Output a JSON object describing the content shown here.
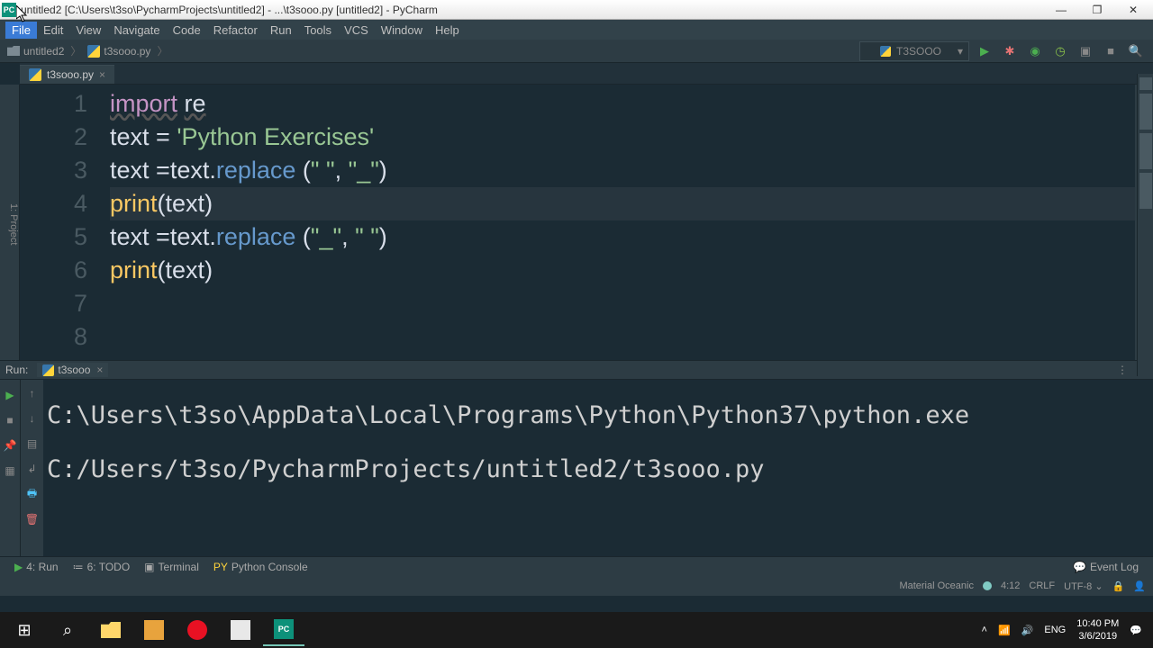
{
  "window": {
    "title": "untitled2 [C:\\Users\\t3so\\PycharmProjects\\untitled2] - ...\\t3sooo.py [untitled2] - PyCharm"
  },
  "menu": [
    "File",
    "Edit",
    "View",
    "Navigate",
    "Code",
    "Refactor",
    "Run",
    "Tools",
    "VCS",
    "Window",
    "Help"
  ],
  "breadcrumb": {
    "project": "untitled2",
    "file": "t3sooo.py"
  },
  "run_config": "T3SOOO",
  "tab": {
    "name": "t3sooo.py"
  },
  "left_gutter": "1: Project",
  "editor": {
    "lines": [
      "1",
      "2",
      "3",
      "4",
      "5",
      "6",
      "7",
      "8"
    ],
    "code": [
      {
        "t": "import",
        "c": "kw imp-u"
      },
      {
        "t": " ",
        "c": ""
      },
      {
        "t": "re",
        "c": "var imp-u"
      },
      {
        "nl": 1
      },
      {
        "t": "text ",
        "c": "var"
      },
      {
        "t": "= ",
        "c": "op"
      },
      {
        "t": "'Python Exercises'",
        "c": "str"
      },
      {
        "nl": 1
      },
      {
        "t": "text ",
        "c": "var"
      },
      {
        "t": "=",
        "c": "op"
      },
      {
        "t": "text",
        "c": "var"
      },
      {
        "t": ".",
        "c": "op"
      },
      {
        "t": "replace",
        "c": "fn"
      },
      {
        "t": " (",
        "c": "op"
      },
      {
        "t": "\" \"",
        "c": "str"
      },
      {
        "t": ", ",
        "c": "op"
      },
      {
        "t": "\"_\"",
        "c": "str"
      },
      {
        "t": ")",
        "c": "op"
      },
      {
        "nl": 1
      },
      {
        "t": "print",
        "c": "bi"
      },
      {
        "t": "(",
        "c": "op"
      },
      {
        "t": "text",
        "c": "var"
      },
      {
        "t": ")",
        "c": "op"
      },
      {
        "nl": 1,
        "hl": 1
      },
      {
        "t": "text ",
        "c": "var"
      },
      {
        "t": "=",
        "c": "op"
      },
      {
        "t": "text",
        "c": "var"
      },
      {
        "t": ".",
        "c": "op"
      },
      {
        "t": "replace",
        "c": "fn"
      },
      {
        "t": " (",
        "c": "op"
      },
      {
        "t": "\"_\"",
        "c": "str"
      },
      {
        "t": ", ",
        "c": "op"
      },
      {
        "t": "\" \"",
        "c": "str"
      },
      {
        "t": ")",
        "c": "op"
      },
      {
        "nl": 1
      },
      {
        "t": "print",
        "c": "bi"
      },
      {
        "t": "(",
        "c": "op"
      },
      {
        "t": "text",
        "c": "var"
      },
      {
        "t": ")",
        "c": "op"
      },
      {
        "nl": 1
      },
      {
        "t": "",
        "c": ""
      },
      {
        "nl": 1
      },
      {
        "t": "",
        "c": ""
      },
      {
        "nl": 1
      }
    ]
  },
  "run": {
    "label": "Run:",
    "tab": "t3sooo",
    "output": "C:\\Users\\t3so\\AppData\\Local\\Programs\\Python\\Python37\\python.exe C:/Users/t3so/PycharmProjects/untitled2/t3sooo.py"
  },
  "bottom": {
    "run": "4: Run",
    "todo": "6: TODO",
    "terminal": "Terminal",
    "python": "Python Console",
    "event": "Event Log"
  },
  "status": {
    "theme": "Material Oceanic",
    "pos": "4:12",
    "eol": "CRLF",
    "enc": "UTF-8"
  },
  "tray": {
    "lang": "ENG",
    "time": "10:40 PM",
    "date": "3/6/2019"
  }
}
